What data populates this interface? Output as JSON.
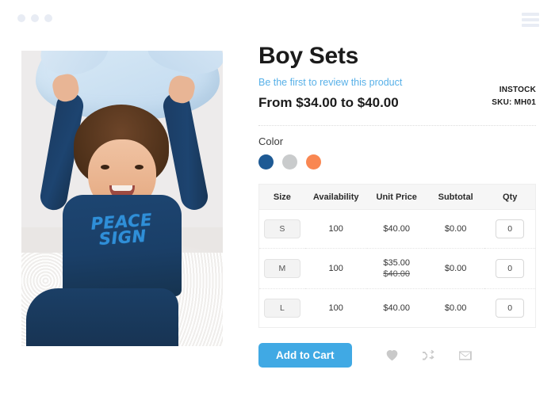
{
  "browser": {
    "dots": [
      "dot-1",
      "dot-2",
      "dot-3"
    ],
    "menu_icon": "hamburger-menu-icon"
  },
  "product": {
    "title": "Boy Sets",
    "review_link": "Be the first to review this product",
    "price_range": "From $34.00 to $40.00",
    "stock_status": "INSTOCK",
    "sku": "SKU: MH01",
    "image": {
      "alt": "Young boy in navy blue set holding a light blue star pillow",
      "shirt_text_line1": "PEACE",
      "shirt_text_line2": "SIGN"
    }
  },
  "options": {
    "color_label": "Color",
    "swatches": [
      {
        "name": "blue",
        "hex": "#1e5a94",
        "selected": true
      },
      {
        "name": "gray",
        "hex": "#c9cbcc",
        "selected": false
      },
      {
        "name": "orange",
        "hex": "#f98752",
        "selected": false
      }
    ]
  },
  "table": {
    "headers": [
      "Size",
      "Availability",
      "Unit Price",
      "Subtotal",
      "Qty"
    ],
    "rows": [
      {
        "size": "S",
        "availability": "100",
        "unit_price": "$40.00",
        "old_price": "",
        "subtotal": "$0.00",
        "qty": "0"
      },
      {
        "size": "M",
        "availability": "100",
        "unit_price": "$35.00",
        "old_price": "$40.00",
        "subtotal": "$0.00",
        "qty": "0"
      },
      {
        "size": "L",
        "availability": "100",
        "unit_price": "$40.00",
        "old_price": "",
        "subtotal": "$0.00",
        "qty": "0"
      }
    ]
  },
  "actions": {
    "add_to_cart_label": "Add to Cart",
    "wishlist_icon": "heart-icon",
    "compare_icon": "shuffle-compare-icon",
    "email_icon": "envelope-icon"
  },
  "colors": {
    "accent_blue": "#40a9e4",
    "link_blue": "#57b0e8",
    "text_dark": "#1b1b1b",
    "header_bg": "#f6f6f6"
  }
}
